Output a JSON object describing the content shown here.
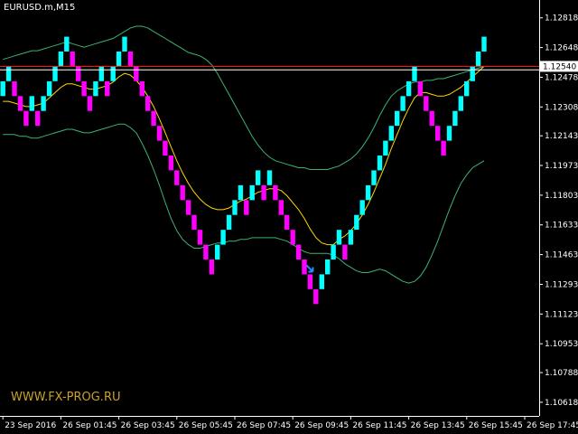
{
  "chart_data": {
    "type": "renko",
    "symbol": "EURUSD.m,M15",
    "watermark": "WWW.FX-PROG.RU",
    "current_price": "1.12540",
    "colors": {
      "background": "#000000",
      "up_brick": "#00ffff",
      "down_brick": "#ff00ff",
      "moving_average": "#ffd700",
      "bands": "#3cb371",
      "current_price_line": "#ff2020",
      "reference_line": "#ffffff",
      "axis": "#ffffff"
    },
    "y_ticks": [
      "1.12818",
      "1.12648",
      "1.12478",
      "1.12308",
      "1.12143",
      "1.11973",
      "1.11803",
      "1.11633",
      "1.11463",
      "1.11293",
      "1.11123",
      "1.10953",
      "1.10788",
      "1.10618"
    ],
    "y_tick_values": [
      1.12818,
      1.12648,
      1.12478,
      1.12308,
      1.12143,
      1.11973,
      1.11803,
      1.11633,
      1.11463,
      1.11293,
      1.11123,
      1.10953,
      1.10788,
      1.10618
    ],
    "ylim": [
      1.1054,
      1.1292
    ],
    "x_ticks": [
      "23 Sep 2016",
      "26 Sep 01:45",
      "26 Sep 03:45",
      "26 Sep 05:45",
      "26 Sep 07:45",
      "26 Sep 09:45",
      "26 Sep 11:45",
      "26 Sep 13:45",
      "26 Sep 15:45",
      "26 Sep 17:45"
    ],
    "x_tick_index": [
      0,
      10,
      20,
      30,
      40,
      50,
      60,
      70,
      80,
      90
    ],
    "xlim": [
      -0.5,
      92.5
    ],
    "brick_size": 0.00085,
    "bricks_top": [
      1.12455,
      1.1254,
      1.12455,
      1.1237,
      1.12285,
      1.1237,
      1.12285,
      1.1237,
      1.12455,
      1.1254,
      1.12625,
      1.1271,
      1.12625,
      1.1254,
      1.12455,
      1.1237,
      1.12455,
      1.1254,
      1.12455,
      1.1254,
      1.12625,
      1.1271,
      1.12625,
      1.1254,
      1.12455,
      1.1237,
      1.12285,
      1.122,
      1.12115,
      1.1203,
      1.11945,
      1.1186,
      1.11775,
      1.1169,
      1.11605,
      1.1152,
      1.11435,
      1.1152,
      1.11605,
      1.1169,
      1.11775,
      1.1186,
      1.11775,
      1.1186,
      1.11945,
      1.1186,
      1.11945,
      1.1186,
      1.11775,
      1.1169,
      1.11605,
      1.1152,
      1.11435,
      1.1135,
      1.11265,
      1.1135,
      1.11435,
      1.1152,
      1.11605,
      1.1152,
      1.11605,
      1.1169,
      1.11775,
      1.1186,
      1.11945,
      1.1203,
      1.12115,
      1.122,
      1.12285,
      1.1237,
      1.12455,
      1.1254,
      1.12455,
      1.1237,
      1.12285,
      1.122,
      1.12115,
      1.122,
      1.12285,
      1.1237,
      1.12455,
      1.1254,
      1.12625,
      1.1271
    ],
    "bricks_dir": [
      "up",
      "up",
      "down",
      "down",
      "down",
      "up",
      "down",
      "up",
      "up",
      "up",
      "up",
      "up",
      "down",
      "down",
      "down",
      "down",
      "up",
      "up",
      "down",
      "up",
      "up",
      "up",
      "down",
      "down",
      "down",
      "down",
      "down",
      "down",
      "down",
      "down",
      "down",
      "down",
      "down",
      "down",
      "down",
      "down",
      "down",
      "up",
      "up",
      "up",
      "up",
      "up",
      "down",
      "up",
      "up",
      "down",
      "up",
      "down",
      "down",
      "down",
      "down",
      "down",
      "down",
      "down",
      "down",
      "up",
      "up",
      "up",
      "up",
      "down",
      "up",
      "up",
      "up",
      "up",
      "up",
      "up",
      "up",
      "up",
      "up",
      "up",
      "up",
      "up",
      "down",
      "down",
      "down",
      "down",
      "down",
      "up",
      "up",
      "up",
      "up",
      "up",
      "up",
      "up"
    ],
    "moving_average": [
      1.1234,
      1.1234,
      1.1233,
      1.1232,
      1.1231,
      1.1231,
      1.1232,
      1.1233,
      1.1236,
      1.1239,
      1.1242,
      1.1244,
      1.1244,
      1.1243,
      1.1242,
      1.1241,
      1.1241,
      1.1242,
      1.1243,
      1.1245,
      1.1248,
      1.125,
      1.1249,
      1.1246,
      1.1242,
      1.1237,
      1.1231,
      1.1224,
      1.1216,
      1.1208,
      1.12,
      1.1193,
      1.1187,
      1.1182,
      1.1178,
      1.1175,
      1.1173,
      1.1172,
      1.1172,
      1.1173,
      1.1175,
      1.1177,
      1.1178,
      1.118,
      1.1182,
      1.1183,
      1.1184,
      1.1184,
      1.1183,
      1.118,
      1.1176,
      1.1172,
      1.1167,
      1.1161,
      1.1156,
      1.1153,
      1.1152,
      1.1152,
      1.1155,
      1.1157,
      1.116,
      1.1164,
      1.1169,
      1.1175,
      1.1182,
      1.119,
      1.1198,
      1.1207,
      1.1215,
      1.1223,
      1.123,
      1.1236,
      1.1239,
      1.1239,
      1.1238,
      1.1237,
      1.1237,
      1.1238,
      1.124,
      1.1242,
      1.1245,
      1.1248,
      1.1251,
      1.1254
    ],
    "upper_band": [
      1.1258,
      1.1259,
      1.126,
      1.1261,
      1.1262,
      1.1263,
      1.1263,
      1.1264,
      1.1265,
      1.1266,
      1.1267,
      1.1268,
      1.1267,
      1.1266,
      1.1265,
      1.1266,
      1.1267,
      1.1268,
      1.1269,
      1.127,
      1.1272,
      1.1274,
      1.1276,
      1.1277,
      1.1277,
      1.1276,
      1.1274,
      1.1272,
      1.127,
      1.1268,
      1.1266,
      1.1264,
      1.1262,
      1.1261,
      1.126,
      1.1258,
      1.1255,
      1.125,
      1.1244,
      1.1238,
      1.1232,
      1.1226,
      1.122,
      1.1214,
      1.1209,
      1.1205,
      1.1202,
      1.12,
      1.1199,
      1.1198,
      1.1197,
      1.1196,
      1.1196,
      1.1195,
      1.1195,
      1.1195,
      1.1195,
      1.1196,
      1.1197,
      1.1199,
      1.1201,
      1.1204,
      1.1208,
      1.1213,
      1.1219,
      1.1226,
      1.1232,
      1.1237,
      1.124,
      1.1242,
      1.1244,
      1.1245,
      1.1245,
      1.1246,
      1.1246,
      1.1247,
      1.1247,
      1.1248,
      1.1249,
      1.125,
      1.1251,
      1.1252,
      1.1253,
      1.1254
    ],
    "lower_band": [
      1.1215,
      1.1215,
      1.1215,
      1.1214,
      1.1214,
      1.1213,
      1.1213,
      1.1214,
      1.1215,
      1.1216,
      1.1217,
      1.1218,
      1.1218,
      1.1217,
      1.1216,
      1.1216,
      1.1217,
      1.1218,
      1.1219,
      1.122,
      1.1221,
      1.1221,
      1.1219,
      1.1216,
      1.121,
      1.1203,
      1.1195,
      1.1186,
      1.1176,
      1.1167,
      1.116,
      1.1155,
      1.1152,
      1.115,
      1.115,
      1.1151,
      1.1152,
      1.1153,
      1.1153,
      1.1154,
      1.1154,
      1.1155,
      1.1155,
      1.1156,
      1.1156,
      1.1156,
      1.1156,
      1.1156,
      1.1155,
      1.1154,
      1.1152,
      1.115,
      1.1148,
      1.1147,
      1.1147,
      1.1147,
      1.1147,
      1.1146,
      1.1144,
      1.1141,
      1.1139,
      1.1137,
      1.1136,
      1.1136,
      1.1137,
      1.1138,
      1.1137,
      1.1135,
      1.1133,
      1.1131,
      1.113,
      1.1131,
      1.1134,
      1.1139,
      1.1146,
      1.1154,
      1.1163,
      1.1172,
      1.118,
      1.1187,
      1.1192,
      1.1196,
      1.1198,
      1.12
    ],
    "current_price_value": 1.1254,
    "reference_value": 1.1252,
    "signal_arrow_index": 53,
    "grid": false
  }
}
